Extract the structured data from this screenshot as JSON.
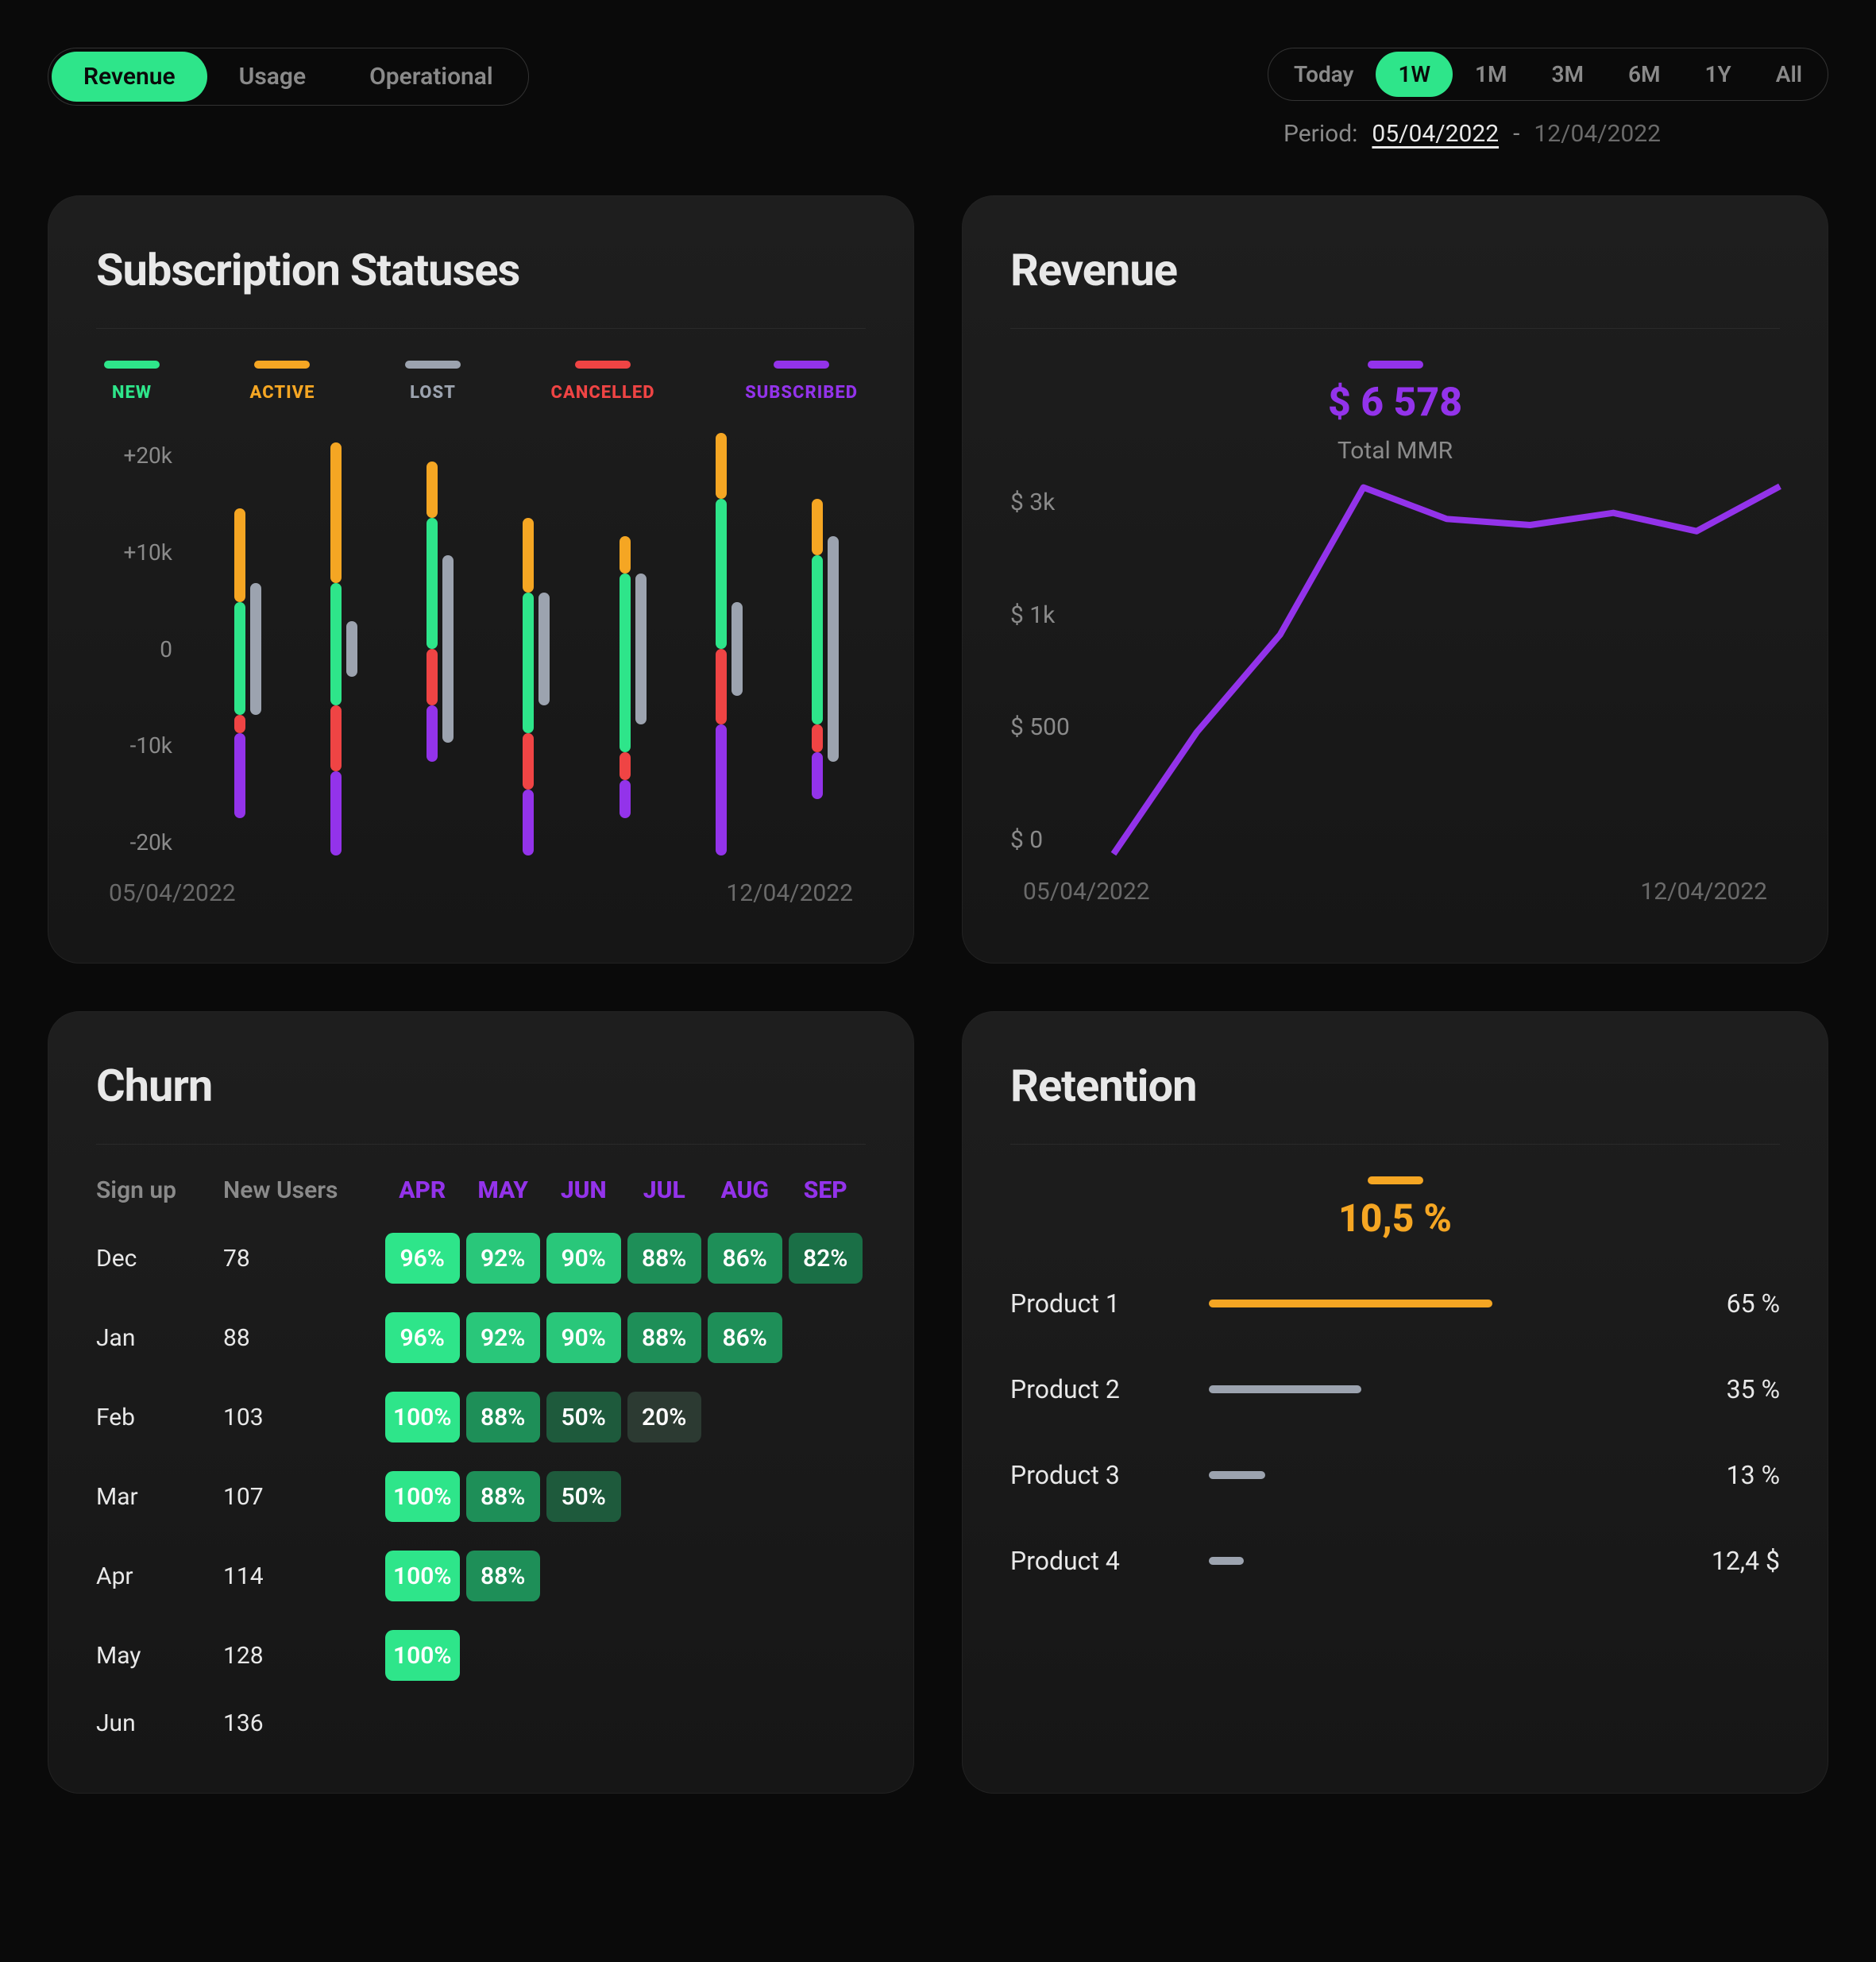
{
  "main_tabs": {
    "items": [
      "Revenue",
      "Usage",
      "Operational"
    ],
    "active_index": 0
  },
  "range_tabs": {
    "items": [
      "Today",
      "1W",
      "1M",
      "3M",
      "6M",
      "1Y",
      "All"
    ],
    "active_index": 1
  },
  "period": {
    "label": "Period:",
    "from": "05/04/2022",
    "sep": "-",
    "to": "12/04/2022"
  },
  "colors": {
    "new": "#2ee58a",
    "active": "#f5a623",
    "lost": "#9ca3af",
    "cancelled": "#ef4444",
    "subscribed": "#9333ea"
  },
  "status_card": {
    "title": "Subscription Statuses",
    "legend": [
      {
        "key": "new",
        "label": "NEW",
        "color": "#2ee58a"
      },
      {
        "key": "active",
        "label": "ACTIVE",
        "color": "#f5a623"
      },
      {
        "key": "lost",
        "label": "LOST",
        "color": "#9ca3af"
      },
      {
        "key": "cancelled",
        "label": "CANCELLED",
        "color": "#ef4444"
      },
      {
        "key": "subscribed",
        "label": "SUBSCRIBED",
        "color": "#9333ea"
      }
    ],
    "y_ticks": [
      "+20k",
      "+10k",
      "0",
      "-10k",
      "-20k"
    ],
    "x_from": "05/04/2022",
    "x_to": "12/04/2022"
  },
  "revenue_card": {
    "title": "Revenue",
    "total_label": "Total MMR",
    "total_value": "$ 6 578",
    "y_ticks": [
      "$ 3k",
      "$ 1k",
      "$ 500",
      "$ 0"
    ],
    "x_from": "05/04/2022",
    "x_to": "12/04/2022"
  },
  "churn_card": {
    "title": "Churn",
    "col_signup": "Sign up",
    "col_newusers": "New Users",
    "months": [
      "APR",
      "MAY",
      "JUN",
      "JUL",
      "AUG",
      "SEP"
    ],
    "rows": [
      {
        "month": "Dec",
        "new_users": "78",
        "cells": [
          "96%",
          "92%",
          "90%",
          "88%",
          "86%",
          "82%"
        ]
      },
      {
        "month": "Jan",
        "new_users": "88",
        "cells": [
          "96%",
          "92%",
          "90%",
          "88%",
          "86%"
        ]
      },
      {
        "month": "Feb",
        "new_users": "103",
        "cells": [
          "100%",
          "88%",
          "50%",
          "20%"
        ]
      },
      {
        "month": "Mar",
        "new_users": "107",
        "cells": [
          "100%",
          "88%",
          "50%"
        ]
      },
      {
        "month": "Apr",
        "new_users": "114",
        "cells": [
          "100%",
          "88%"
        ]
      },
      {
        "month": "May",
        "new_users": "128",
        "cells": [
          "100%"
        ]
      },
      {
        "month": "Jun",
        "new_users": "136",
        "cells": []
      }
    ]
  },
  "retention_card": {
    "title": "Retention",
    "headline": "10,5 %",
    "rows": [
      {
        "label": "Product 1",
        "value": "65 %",
        "pct": 65,
        "color": "#f5a623"
      },
      {
        "label": "Product 2",
        "value": "35 %",
        "pct": 35,
        "color": "#9ca3af"
      },
      {
        "label": "Product 3",
        "value": "13 %",
        "pct": 13,
        "color": "#9ca3af"
      },
      {
        "label": "Product 4",
        "value": "12,4 $",
        "pct": 8,
        "color": "#9ca3af"
      }
    ]
  },
  "chart_data": [
    {
      "id": "subscription_statuses",
      "type": "bar",
      "title": "Subscription Statuses",
      "y_unit": "k",
      "ylim": [
        -20,
        20
      ],
      "x_range": [
        "05/04/2022",
        "12/04/2022"
      ],
      "note": "stacked diverging bars; 7 days between x_range; segments = {name:[from,to] in k}",
      "series_names": [
        "NEW",
        "ACTIVE",
        "LOST",
        "CANCELLED",
        "SUBSCRIBED"
      ],
      "days": [
        {
          "active": [
            5,
            15
          ],
          "new": [
            -7,
            5
          ],
          "cancelled": [
            -9,
            -7
          ],
          "subscribed": [
            -18,
            -9
          ],
          "lost": [
            -7,
            7
          ]
        },
        {
          "active": [
            7,
            22
          ],
          "new": [
            -6,
            7
          ],
          "cancelled": [
            -13,
            -6
          ],
          "subscribed": [
            -22,
            -13
          ],
          "lost": [
            -3,
            3
          ]
        },
        {
          "active": [
            14,
            20
          ],
          "new": [
            0,
            14
          ],
          "cancelled": [
            -6,
            0
          ],
          "subscribed": [
            -12,
            -6
          ],
          "lost": [
            -10,
            10
          ]
        },
        {
          "active": [
            6,
            14
          ],
          "new": [
            -9,
            6
          ],
          "cancelled": [
            -15,
            -9
          ],
          "subscribed": [
            -22,
            -15
          ],
          "lost": [
            -6,
            6
          ]
        },
        {
          "active": [
            8,
            12
          ],
          "new": [
            -11,
            8
          ],
          "cancelled": [
            -14,
            -11
          ],
          "subscribed": [
            -18,
            -14
          ],
          "lost": [
            -8,
            8
          ]
        },
        {
          "active": [
            16,
            23
          ],
          "new": [
            0,
            16
          ],
          "cancelled": [
            -8,
            0
          ],
          "subscribed": [
            -22,
            -8
          ],
          "lost": [
            -5,
            5
          ]
        },
        {
          "active": [
            10,
            16
          ],
          "new": [
            -8,
            10
          ],
          "cancelled": [
            -11,
            -8
          ],
          "subscribed": [
            -16,
            -11
          ],
          "lost": [
            -12,
            12
          ]
        }
      ]
    },
    {
      "id": "revenue_line",
      "type": "line",
      "title": "Revenue",
      "ylabel": "$",
      "y_ticks": [
        0,
        500,
        1000,
        3000
      ],
      "x_range": [
        "05/04/2022",
        "12/04/2022"
      ],
      "values": [
        0,
        500,
        900,
        3100,
        2500,
        2400,
        2600,
        2300,
        3200
      ],
      "total": 6578,
      "total_label": "Total MMR"
    },
    {
      "id": "churn_cohort",
      "type": "table",
      "title": "Churn",
      "columns": [
        "Sign up",
        "New Users",
        "APR",
        "MAY",
        "JUN",
        "JUL",
        "AUG",
        "SEP"
      ],
      "rows": [
        [
          "Dec",
          78,
          96,
          92,
          90,
          88,
          86,
          82
        ],
        [
          "Jan",
          88,
          96,
          92,
          90,
          88,
          86,
          null
        ],
        [
          "Feb",
          103,
          100,
          88,
          50,
          20,
          null,
          null
        ],
        [
          "Mar",
          107,
          100,
          88,
          50,
          null,
          null,
          null
        ],
        [
          "Apr",
          114,
          100,
          88,
          null,
          null,
          null,
          null
        ],
        [
          "May",
          128,
          100,
          null,
          null,
          null,
          null,
          null
        ],
        [
          "Jun",
          136,
          null,
          null,
          null,
          null,
          null,
          null
        ]
      ],
      "unit": "%"
    },
    {
      "id": "retention_bars",
      "type": "bar",
      "title": "Retention",
      "headline": "10,5 %",
      "categories": [
        "Product 1",
        "Product 2",
        "Product 3",
        "Product 4"
      ],
      "values_display": [
        "65 %",
        "35 %",
        "13 %",
        "12,4 $"
      ],
      "values": [
        65,
        35,
        13,
        12.4
      ]
    }
  ]
}
